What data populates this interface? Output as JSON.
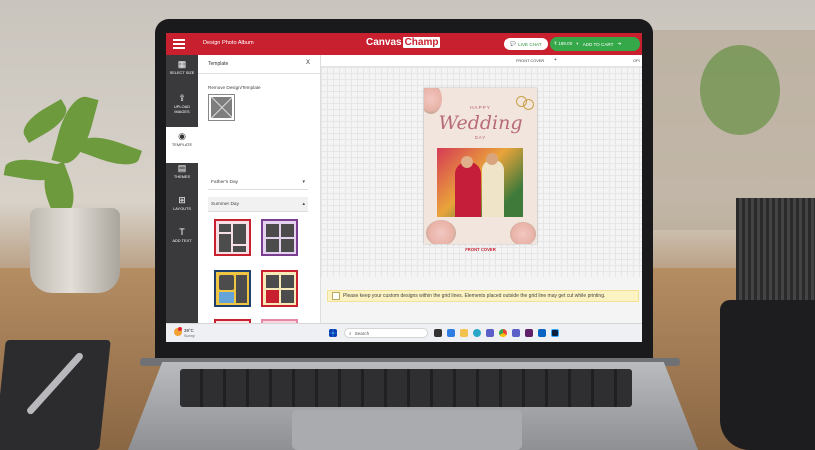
{
  "app": {
    "title": "Design Photo Album",
    "logo_text": "Canvas",
    "logo_box_text": "Champ",
    "live_chat": "LIVE CHAT",
    "price": "₹ 189.00",
    "add_to_cart": "ADD TO CART"
  },
  "sidebar": {
    "items": [
      {
        "label": "SELECT SIZE",
        "icon": "grid-icon"
      },
      {
        "label": "UPLOAD IMAGES",
        "icon": "upload-icon"
      },
      {
        "label": "TEMPLATE",
        "icon": "template-icon",
        "active": true
      },
      {
        "label": "THEMES",
        "icon": "themes-icon"
      },
      {
        "label": "LAYOUTS",
        "icon": "layouts-icon"
      },
      {
        "label": "ADD TEXT",
        "icon": "text-icon"
      }
    ]
  },
  "panel": {
    "title": "Template",
    "close": "X",
    "remove_label": "Remove Design/Template",
    "accordions": [
      {
        "label": "Father's Day",
        "caret": "▾"
      },
      {
        "label": "Summer Day",
        "caret": "▴"
      }
    ]
  },
  "canvas": {
    "tab": "FRONT COVER",
    "plus": "+",
    "option": "OPI",
    "cover_happy": "HAPPY",
    "cover_wedding": "Wedding",
    "cover_day": "DAY",
    "cover_label": "FRONT COVER",
    "notice": "Please keep your custom designs within the grid lines. Elements placed outside the grid line may get cut while printing."
  },
  "taskbar": {
    "temp": "39°C",
    "weather": "Sunny",
    "search_placeholder": "Search"
  },
  "colors": {
    "brand_red": "#c8202f",
    "cart_green": "#35a84a",
    "sidebar_dark": "#3a3a3c",
    "notice_bg": "#fdf3c2"
  }
}
